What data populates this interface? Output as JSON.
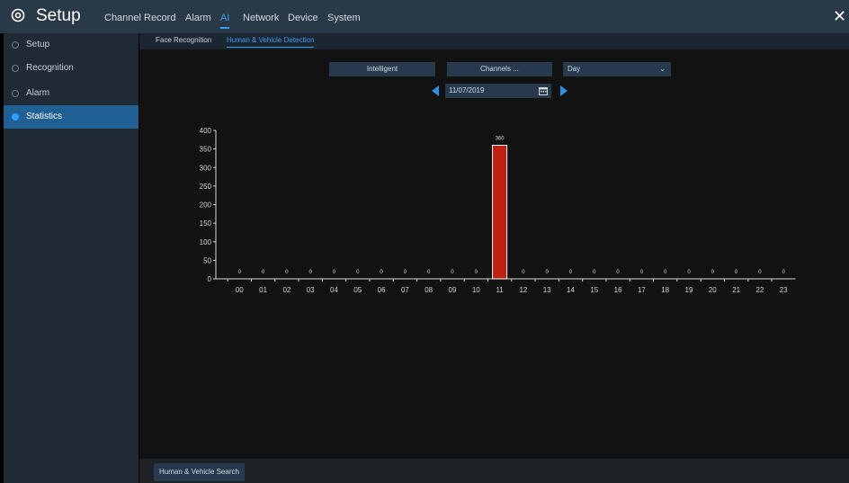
{
  "app": {
    "title": "Setup",
    "close_symbol": "✕"
  },
  "top_nav": [
    "Channel",
    "Record",
    "Alarm",
    "AI",
    "Network",
    "Device",
    "System"
  ],
  "top_nav_active": "AI",
  "sidebar": {
    "items": [
      {
        "label": "Setup"
      },
      {
        "label": "Recognition"
      },
      {
        "label": "Alarm"
      },
      {
        "label": "Statistics"
      }
    ],
    "active": "Statistics"
  },
  "sub_tabs": [
    "Face Recognition",
    "Human & Vehicle Detection"
  ],
  "sub_tab_active": "Human & Vehicle Detection",
  "controls": {
    "intelligent_label": "Intelligent",
    "channels_label": "Channels ...",
    "period_value": "Day",
    "date_value": "11/07/2019"
  },
  "bottom": {
    "search_label": "Human & Vehicle Search"
  },
  "colors": {
    "accent": "#2a8fe8",
    "bar": "#c0200f",
    "active_side": "#1f5f93"
  },
  "chart_data": {
    "type": "bar",
    "categories": [
      "00",
      "01",
      "02",
      "03",
      "04",
      "05",
      "06",
      "07",
      "08",
      "09",
      "10",
      "11",
      "12",
      "13",
      "14",
      "15",
      "16",
      "17",
      "18",
      "19",
      "20",
      "21",
      "22",
      "23"
    ],
    "values": [
      0,
      0,
      0,
      0,
      0,
      0,
      0,
      0,
      0,
      0,
      0,
      360,
      0,
      0,
      0,
      0,
      0,
      0,
      0,
      0,
      0,
      0,
      0,
      0
    ],
    "yticks": [
      0,
      50,
      100,
      150,
      200,
      250,
      300,
      350,
      400
    ],
    "ylim": [
      0,
      400
    ],
    "data_labels": true
  }
}
